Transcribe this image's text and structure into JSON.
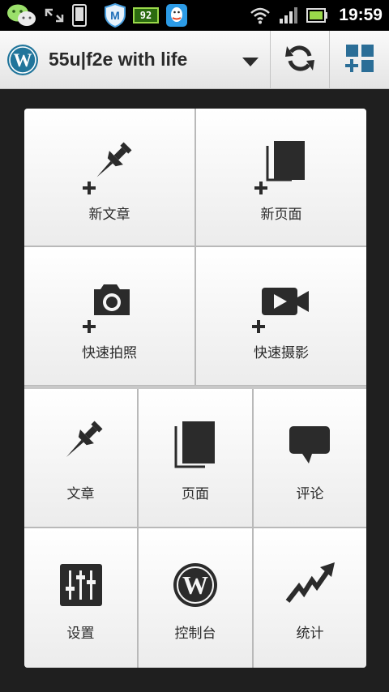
{
  "status_bar": {
    "time": "19:59",
    "battery_level": "92",
    "icons": [
      "wechat-icon",
      "expand-arrows-icon",
      "phone-icon",
      "shield-m-icon",
      "battery-level-icon",
      "qq-icon",
      "wifi-icon",
      "signal-icon",
      "battery-icon"
    ]
  },
  "action_bar": {
    "site_title": "55u|f2e with life",
    "logo": "wordpress-logo",
    "refresh_icon": "refresh-icon",
    "add_widget_icon": "add-widget-icon"
  },
  "dashboard": {
    "new_post": "新文章",
    "new_page": "新页面",
    "quick_photo": "快速拍照",
    "quick_video": "快速摄影",
    "posts": "文章",
    "pages": "页面",
    "comments": "评论",
    "settings": "设置",
    "dashboard": "控制台",
    "stats": "统计"
  },
  "colors": {
    "background": "#1f1f1f",
    "tile_top": "#ffffff",
    "tile_bottom": "#ececec",
    "icon_dark": "#2b2b2b",
    "wordpress_blue": "#21759b"
  }
}
